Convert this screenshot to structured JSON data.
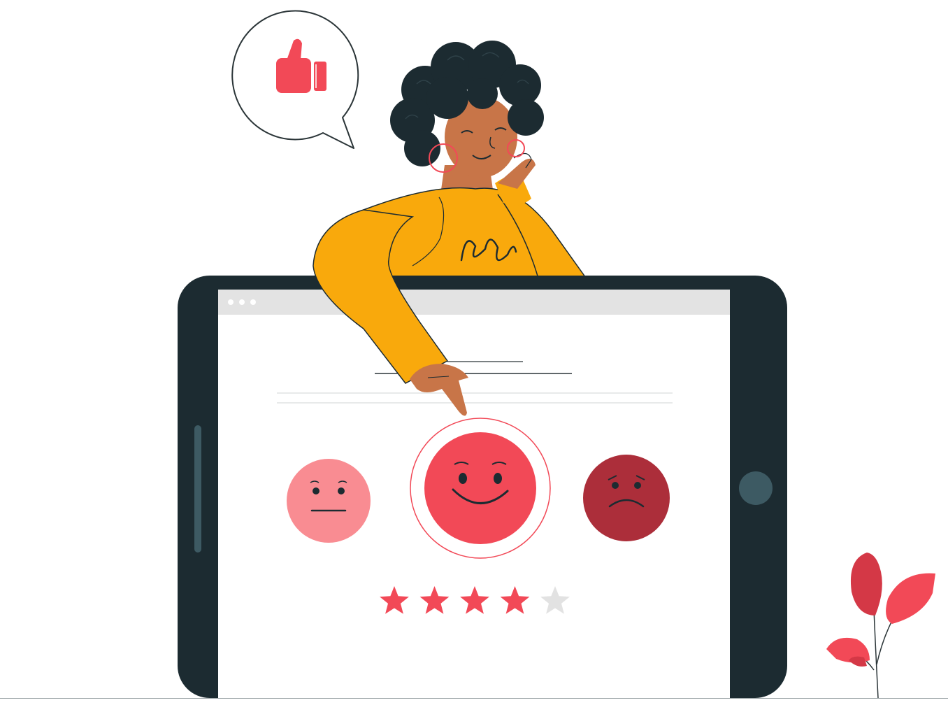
{
  "illustration": {
    "rating": {
      "filled_stars": 4,
      "total_stars": 5
    },
    "selected_face": "happy",
    "faces": [
      "neutral",
      "happy",
      "sad"
    ],
    "bubble_icon": "thumbs-up-icon",
    "colors": {
      "tablet_frame": "#1c2b31",
      "screen": "#ffffff",
      "browser_bar": "#e3e3e3",
      "sweater": "#f9a90c",
      "skin": "#c87548",
      "hair": "#1c2b31",
      "accent_red": "#f24957",
      "neutral_face": "#f98c92",
      "sad_face": "#ac2e3a",
      "star_empty": "#e2e2e2",
      "home_button": "#3d5a63"
    }
  }
}
